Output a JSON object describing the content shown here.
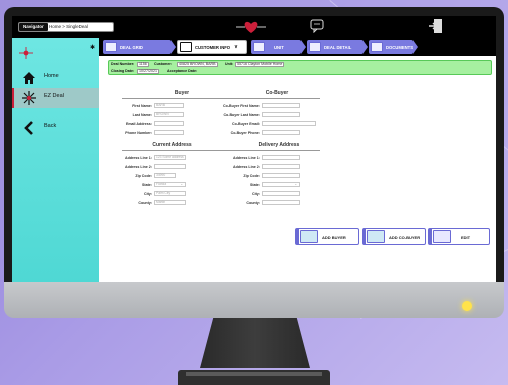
{
  "nav": {
    "label": "Navigator",
    "path": "Home > SingleDeal"
  },
  "sidebar": {
    "items": [
      {
        "label": "Home"
      },
      {
        "label": "EZ Deal"
      },
      {
        "label": "Back"
      }
    ]
  },
  "tabs": [
    {
      "label": "DEAL GRID"
    },
    {
      "label": "CUSTOMER INFO"
    },
    {
      "label": "UNIT"
    },
    {
      "label": "DEAL DETAIL"
    },
    {
      "label": "DOCUMENTS"
    }
  ],
  "deal": {
    "number_label": "Deal Number:",
    "number_value": "1156",
    "customer_label": "Customer:",
    "customer_value": "40825 BROWN, BARB",
    "unit_label": "Unit:",
    "unit_value": "55716 Clayton Mobile Home",
    "closing_label": "Closing Date:",
    "closing_value": "10/27/2021",
    "acceptance_label": "Acceptance Date:"
  },
  "buyer": {
    "heading": "Buyer",
    "first_name_label": "First Name:",
    "first_name": "BARB",
    "last_name_label": "Last Name:",
    "last_name": "BROWN",
    "email_label": "Email Address:",
    "email": "",
    "phone_label": "Phone Number:",
    "phone": ""
  },
  "cobuyer": {
    "heading": "Co-Buyer",
    "first_name_label": "Co-Buyer First Name:",
    "last_name_label": "Co-Buyer Last Name:",
    "email_label": "Co-Buyer Email:",
    "phone_label": "Co-Buyer Phone:"
  },
  "current_address": {
    "heading": "Current Address",
    "line1_label": "Address Line 1:",
    "line1": "123 Some address",
    "line2_label": "Address Line 2:",
    "line2": "",
    "zip_label": "Zip Code:",
    "zip": "34990",
    "state_label": "State:",
    "state": "Florida",
    "city_label": "City:",
    "city": "Palm City",
    "county_label": "County:",
    "county": "Martin"
  },
  "delivery_address": {
    "heading": "Delivery Address",
    "line1_label": "Address Line 1:",
    "line2_label": "Address Line 2:",
    "zip_label": "Zip Code:",
    "state_label": "State:",
    "city_label": "City:",
    "county_label": "County:"
  },
  "buttons": {
    "add_buyer": "ADD BUYER",
    "add_cobuyer": "ADD CO-BUYER",
    "edit": "EDIT"
  },
  "colors": {
    "sidebar": "#4fd8d4",
    "tab_accent": "#7a7ae0",
    "deal_bar": "#a6f0a0",
    "brand_red": "#cc1f3a",
    "led": "#ffe34a"
  }
}
